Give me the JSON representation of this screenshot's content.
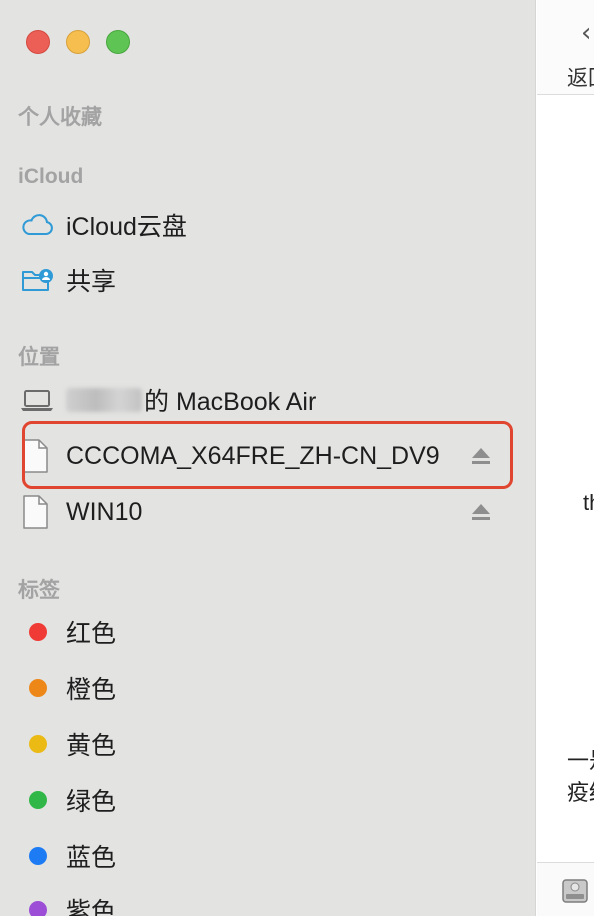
{
  "window": {
    "traffic_lights": [
      "close",
      "minimize",
      "zoom"
    ]
  },
  "sidebar": {
    "favorites": {
      "header": "个人收藏"
    },
    "icloud": {
      "header": "iCloud",
      "items": [
        {
          "label": "iCloud云盘",
          "icon": "cloud-icon"
        },
        {
          "label": "共享",
          "icon": "shared-folder-icon"
        }
      ]
    },
    "locations": {
      "header": "位置",
      "items": [
        {
          "label": "的 MacBook Air",
          "icon": "laptop-icon",
          "redacted_prefix": true
        },
        {
          "label": "CCCOMA_X64FRE_ZH-CN_DV9",
          "icon": "document-icon",
          "ejectable": true,
          "highlighted": true
        },
        {
          "label": "WIN10",
          "icon": "document-icon",
          "ejectable": true
        }
      ]
    },
    "tags": {
      "header": "标签",
      "items": [
        {
          "label": "红色",
          "color": "#f03a35"
        },
        {
          "label": "橙色",
          "color": "#ed8718"
        },
        {
          "label": "黄色",
          "color": "#ecba14"
        },
        {
          "label": "绿色",
          "color": "#30b747"
        },
        {
          "label": "蓝色",
          "color": "#1d7cf3"
        },
        {
          "label": "紫色",
          "color": "#9c4fd6"
        }
      ]
    }
  },
  "main": {
    "toolbar": {
      "back_label": "返回"
    },
    "fragments": {
      "line1": "th",
      "line2": "一是",
      "line3": "疫结"
    }
  },
  "colors": {
    "highlight_box": "#e0452f",
    "section_header": "#a3a3a3",
    "sidebar_bg": "#e3e3e2"
  }
}
